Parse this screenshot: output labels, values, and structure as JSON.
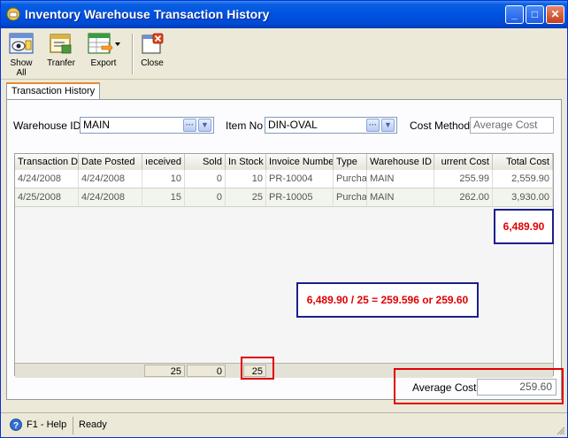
{
  "window": {
    "title": "Inventory Warehouse Transaction History",
    "buttons": {
      "minimize": "_",
      "maximize": "□",
      "close": "✕"
    }
  },
  "toolbar": {
    "show_all": "Show All",
    "transfer": "Tranfer",
    "export": "Export",
    "close": "Close"
  },
  "tabs": [
    {
      "label": "Transaction History",
      "active": true
    }
  ],
  "filters": {
    "warehouse_label": "Warehouse ID",
    "warehouse_value": "MAIN",
    "item_label": "Item No",
    "item_value": "DIN-OVAL",
    "cost_method_label": "Cost Method",
    "cost_method_placeholder": "Average Cost",
    "ellipsis": "···",
    "dropdown": "▼"
  },
  "grid": {
    "columns": [
      "Transaction D",
      "Date Posted",
      "ıeceived",
      "Sold",
      "In Stock",
      "Invoice Numbe",
      "Type",
      "Warehouse ID",
      "urrent Cost",
      "Total Cost"
    ],
    "rows": [
      [
        "4/24/2008",
        "4/24/2008",
        "10",
        "0",
        "10",
        "PR-10004",
        "Purcha",
        "MAIN",
        "255.99",
        "2,559.90"
      ],
      [
        "4/25/2008",
        "4/24/2008",
        "15",
        "0",
        "25",
        "PR-10005",
        "Purcha",
        "MAIN",
        "262.00",
        "3,930.00"
      ]
    ],
    "footer": {
      "received_total": "25",
      "sold_total": "0",
      "in_stock_total": "25"
    }
  },
  "annotations": {
    "total_cost_sum": "6,489.90",
    "formula": "6,489.90 / 25 = 259.596 or 259.60"
  },
  "summary": {
    "average_cost_label": "Average Cost",
    "average_cost_value": "259.60"
  },
  "status": {
    "help": "F1 - Help",
    "state": "Ready"
  },
  "colors": {
    "title_bar": "#0054e3",
    "highlight_red": "#e00000",
    "annotation_blue": "#1a1f8c"
  }
}
